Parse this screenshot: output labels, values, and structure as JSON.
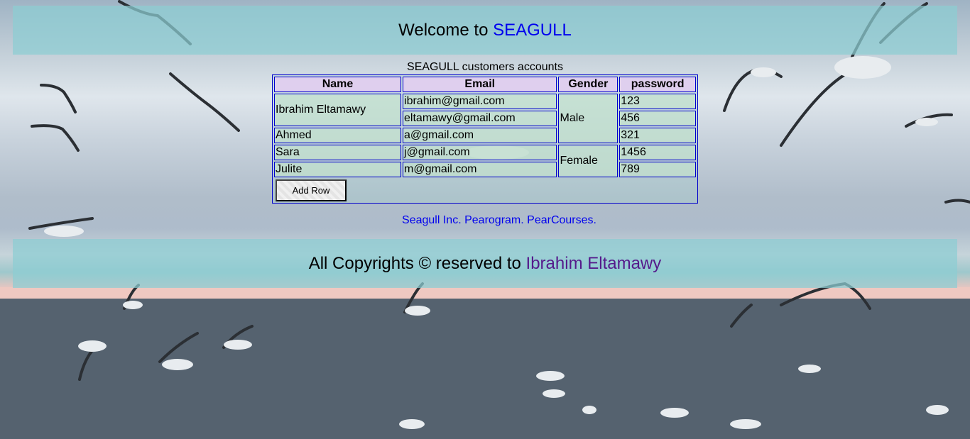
{
  "header": {
    "welcome_text": "Welcome to",
    "brand_name": "SEAGULL"
  },
  "table": {
    "caption": "SEAGULL customers accounts",
    "columns": [
      "Name",
      "Email",
      "Gender",
      "password"
    ],
    "rows": [
      {
        "name": "Ibrahim Eltamawy",
        "email": "ibrahim@gmail.com",
        "gender": "Male",
        "password": "123"
      },
      {
        "email": "eltamawy@gmail.com",
        "password": "456"
      },
      {
        "name": "Ahmed",
        "email": "a@gmail.com",
        "password": "321"
      },
      {
        "name": "Sara",
        "email": "j@gmail.com",
        "gender": "Female",
        "password": "1456"
      },
      {
        "name": "Julite",
        "email": "m@gmail.com",
        "password": "789"
      }
    ],
    "add_row_label": "Add Row"
  },
  "links": [
    "Seagull Inc.",
    "Pearogram.",
    "PearCourses."
  ],
  "footer": {
    "copyright_text": "All Copyrights © reserved to",
    "author_name": "Ibrahim Eltamawy"
  },
  "colors": {
    "link": "#0000ee",
    "visited_link": "#551a8b",
    "band": "#8ccdd2",
    "table_border": "#0000cc"
  }
}
